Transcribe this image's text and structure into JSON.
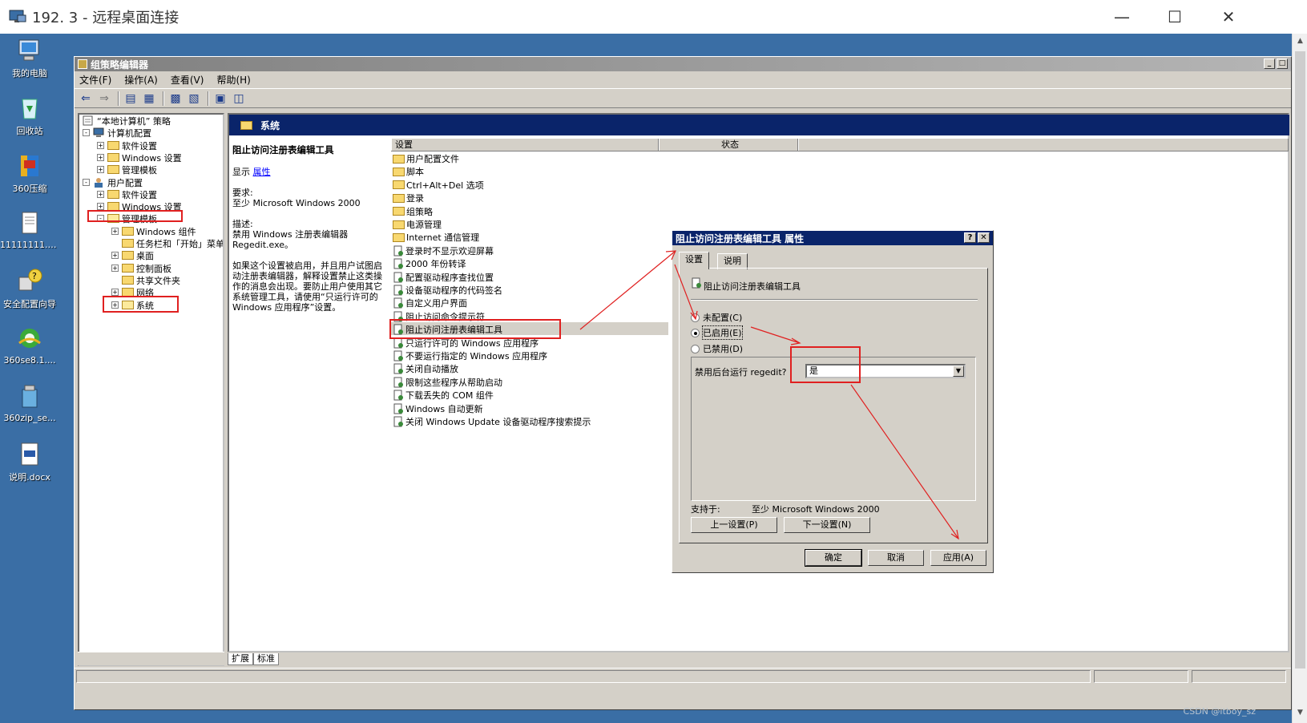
{
  "rdp": {
    "title": "192.      3 - 远程桌面连接"
  },
  "desktop_icons": [
    {
      "label": "我的电脑",
      "icon": "computer-icon"
    },
    {
      "label": "回收站",
      "icon": "recycle-bin-icon"
    },
    {
      "label": "360压缩",
      "icon": "archive-icon"
    },
    {
      "label": "11111111.txt",
      "icon": "text-file-icon"
    },
    {
      "label": "安全配置向导",
      "icon": "security-wizard-icon"
    },
    {
      "label": "360se8.1....",
      "icon": "browser-icon"
    },
    {
      "label": "360zip_se...",
      "icon": "installer-icon"
    },
    {
      "label": "说明.docx",
      "icon": "document-icon"
    }
  ],
  "gpe": {
    "title": "组策略编辑器",
    "menu": [
      "文件(F)",
      "操作(A)",
      "查看(V)",
      "帮助(H)"
    ],
    "tree": {
      "root": "“本地计算机” 策略",
      "computer": "计算机配置",
      "c_software": "软件设置",
      "c_windows": "Windows 设置",
      "c_admin": "管理模板",
      "user": "用户配置",
      "u_software": "软件设置",
      "u_windows": "Windows 设置",
      "u_admin": "管理模板",
      "a_wincomp": "Windows 组件",
      "a_taskbar": "任务栏和「开始」菜单",
      "a_desktop": "桌面",
      "a_control": "控制面板",
      "a_shared": "共享文件夹",
      "a_network": "网络",
      "a_system": "系统"
    },
    "right_header": "系统",
    "desc": {
      "title": "阻止访问注册表编辑工具",
      "show": "显示",
      "props_link": "属性",
      "req_label": "要求:",
      "req_text": "至少 Microsoft Windows 2000",
      "desc_label": "描述:",
      "desc_text1": "禁用 Windows 注册表编辑器",
      "desc_text2": "Regedit.exe。",
      "desc_body": "如果这个设置被启用，并且用户试图启动注册表编辑器，解释设置禁止这类操作的消息会出现。要防止用户使用其它系统管理工具，请使用“只运行许可的 Windows 应用程序”设置。"
    },
    "list_headers": [
      "设置",
      "状态"
    ],
    "folders": [
      "用户配置文件",
      "脚本",
      "Ctrl+Alt+Del 选项",
      "登录",
      "组策略",
      "电源管理",
      "Internet 通信管理"
    ],
    "settings": [
      "登录时不显示欢迎屏幕",
      "2000 年份转译",
      "配置驱动程序查找位置",
      "设备驱动程序的代码签名",
      "自定义用户界面",
      "阻止访问命令提示符",
      "阻止访问注册表编辑工具",
      "只运行许可的 Windows 应用程序",
      "不要运行指定的 Windows 应用程序",
      "关闭自动播放",
      "限制这些程序从帮助启动",
      "下载丢失的 COM 组件",
      "Windows 自动更新",
      "关闭 Windows Update 设备驱动程序搜索提示"
    ],
    "view_tabs": [
      "扩展",
      "标准"
    ]
  },
  "dialog": {
    "title": "阻止访问注册表编辑工具 属性",
    "tabs": [
      "设置",
      "说明"
    ],
    "setting_name": "阻止访问注册表编辑工具",
    "radios": [
      "未配置(C)",
      "已启用(E)",
      "已禁用(D)"
    ],
    "selected_radio": "已启用(E)",
    "option_label": "禁用后台运行 regedit?",
    "option_value": "是",
    "supported_label": "支持于:",
    "supported_value": "至少 Microsoft Windows 2000",
    "prev_btn": "上一设置(P)",
    "next_btn": "下一设置(N)",
    "ok": "确定",
    "cancel": "取消",
    "apply": "应用(A)"
  },
  "watermark": "CSDN @itboy_sz",
  "colors": {
    "desktop": "#3a6ea5",
    "title_active": "#0a246a",
    "annotation": "#e02020"
  }
}
